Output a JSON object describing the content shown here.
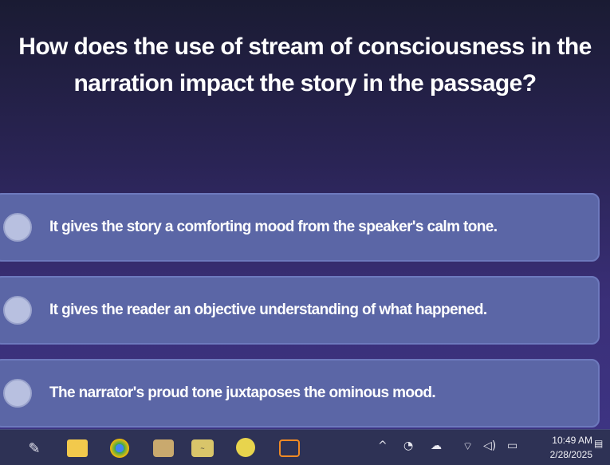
{
  "question": {
    "line1": "How does the use of stream of consciousness in the",
    "line2": "narration impact the story in the passage?"
  },
  "answers": [
    {
      "text": "It gives the story a comforting mood from the speaker's calm tone."
    },
    {
      "text": "It gives the reader an objective understanding of what happened."
    },
    {
      "text": "The narrator's proud tone juxtaposes the ominous mood."
    }
  ],
  "taskbar": {
    "clock_time": "10:49 AM",
    "clock_date": "2/28/2025",
    "icons": [
      "pen-icon",
      "file-explorer-icon",
      "chrome-icon",
      "calendar-app-icon",
      "handwriting-app-icon",
      "paint-icon",
      "kami-icon"
    ],
    "tray_icons": [
      "chevron-up-icon",
      "recorder-icon",
      "cloud-icon",
      "wifi-icon",
      "speaker-icon",
      "battery-icon",
      "notification-icon"
    ]
  },
  "colors": {
    "background_top": "#1a1b33",
    "background_bottom": "#3e3585",
    "answer_fill": "#5b66a6",
    "radio_fill": "#b8c0e0",
    "text": "#ffffff"
  }
}
